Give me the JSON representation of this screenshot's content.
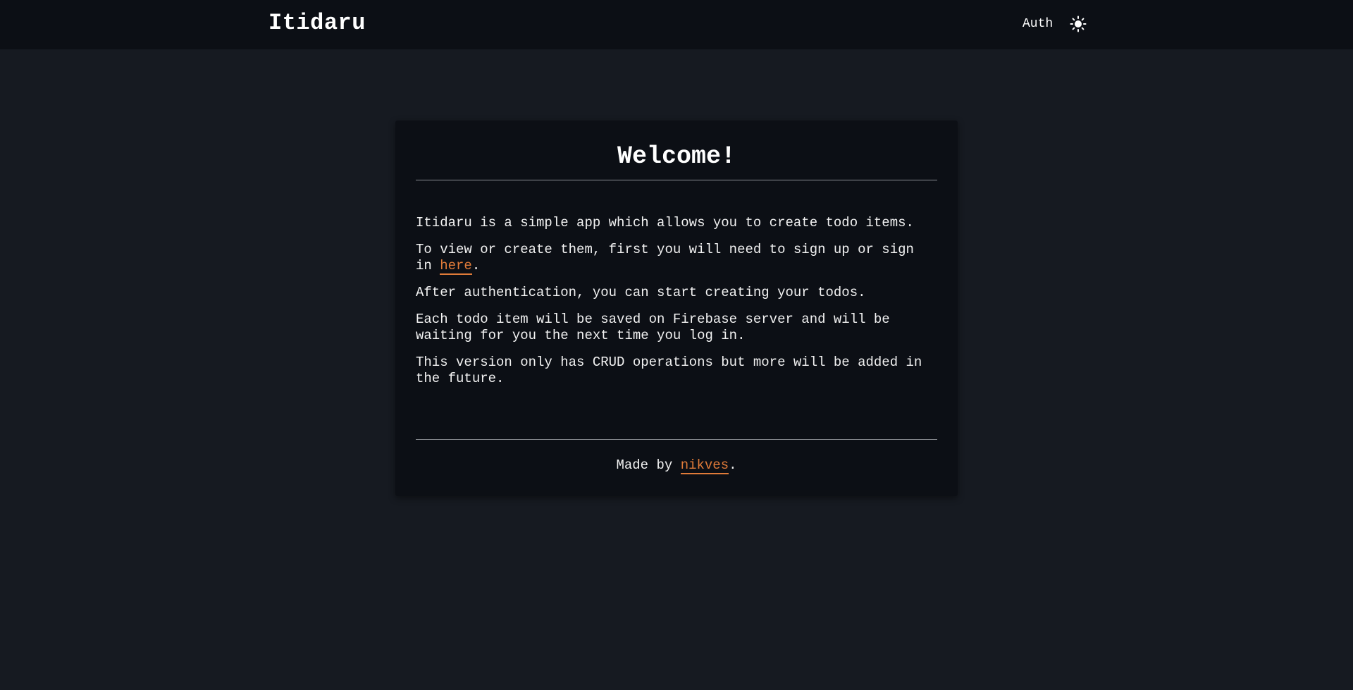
{
  "header": {
    "brand": "Itidaru",
    "auth_link": "Auth",
    "theme_icon": "sun-icon"
  },
  "card": {
    "title": "Welcome!",
    "p1": "Itidaru is a simple app which allows you to create todo items.",
    "p2_before": "To view or create them, first you will need to sign up or sign in ",
    "p2_link": "here",
    "p2_after": ".",
    "p3": "After authentication, you can start creating your todos.",
    "p4": "Each todo item will be saved on Firebase server and will be waiting for you the next time you log in.",
    "p5": "This version only has CRUD operations but more will be added in the future.",
    "footer_before": "Made by ",
    "footer_link": "nikves",
    "footer_after": "."
  },
  "colors": {
    "background": "#161a21",
    "surface": "#0c0f15",
    "accent": "#e07b39",
    "text": "#f2f2f2"
  }
}
